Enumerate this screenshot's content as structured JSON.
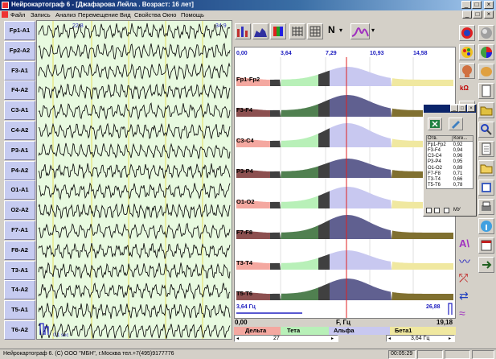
{
  "window": {
    "title": "Нейрокартограф 6 - [Джафарова Лейла . Возраст: 16 лет]",
    "controls": [
      "_",
      "□",
      "×"
    ],
    "mdi_controls": [
      "_",
      "□",
      "×"
    ]
  },
  "menu": [
    "Файл",
    "Запись",
    "Анализ",
    "Перемещение",
    "Вид",
    "Свойства",
    "Окно",
    "Помощь"
  ],
  "channels": [
    "Fp1-A1",
    "Fp2-A2",
    "F3-A1",
    "F4-A2",
    "C3-A1",
    "C4-A2",
    "P3-A1",
    "P4-A2",
    "O1-A1",
    "O2-A2",
    "F7-A1",
    "F8-A2",
    "T3-A1",
    "T4-A2",
    "T5-A1",
    "T6-A2"
  ],
  "eeg": {
    "time_left": "22:8",
    "time_right": "34:9",
    "scale_label": "0.1 sec"
  },
  "spectrum": {
    "freq_ticks": [
      "0,00",
      "3,64",
      "7,29",
      "10,93",
      "14,58"
    ],
    "pairs": [
      "Fp1-Fp2",
      "F3-F4",
      "C3-C4",
      "P3-P4",
      "O1-O2",
      "F7-F8",
      "T3-T4",
      "T5-T6"
    ],
    "left_value": "3,64 Гц",
    "right_value": "26,88",
    "axis_start": "0,00",
    "axis_label": "F, Гц",
    "axis_end": "19,18",
    "bands": [
      "Дельта",
      "Тета",
      "Альфа",
      "Бета1"
    ],
    "scroll_left_value": "27",
    "scroll_right_value": "3,64 Гц",
    "band_colors": {
      "delta": "#f4a8a0",
      "theta": "#b8f0b8",
      "alpha": "#c8c8f0",
      "beta1": "#f0e8a0"
    }
  },
  "popup": {
    "headers": [
      "Отв.",
      "Коге..."
    ],
    "rows": [
      [
        "Fp1-Fp2",
        "0,92"
      ],
      [
        "F3-F4",
        "0,94"
      ],
      [
        "C3-C4",
        "0,96"
      ],
      [
        "P3-P4",
        "0,95"
      ],
      [
        "O1-O2",
        "0,89"
      ],
      [
        "F7-F8",
        "0,71"
      ],
      [
        "T3-T4",
        "0,66"
      ],
      [
        "T5-T6",
        "0,78"
      ]
    ],
    "footer": "МУ"
  },
  "status": {
    "left": "Нейрокартограф 6. (С) ООО \"МБН\", г.Москва тел.+7(495)9177776",
    "time": "00:05:29"
  },
  "toolbar": {
    "n_label": "N",
    "k_label": "kΩ"
  }
}
